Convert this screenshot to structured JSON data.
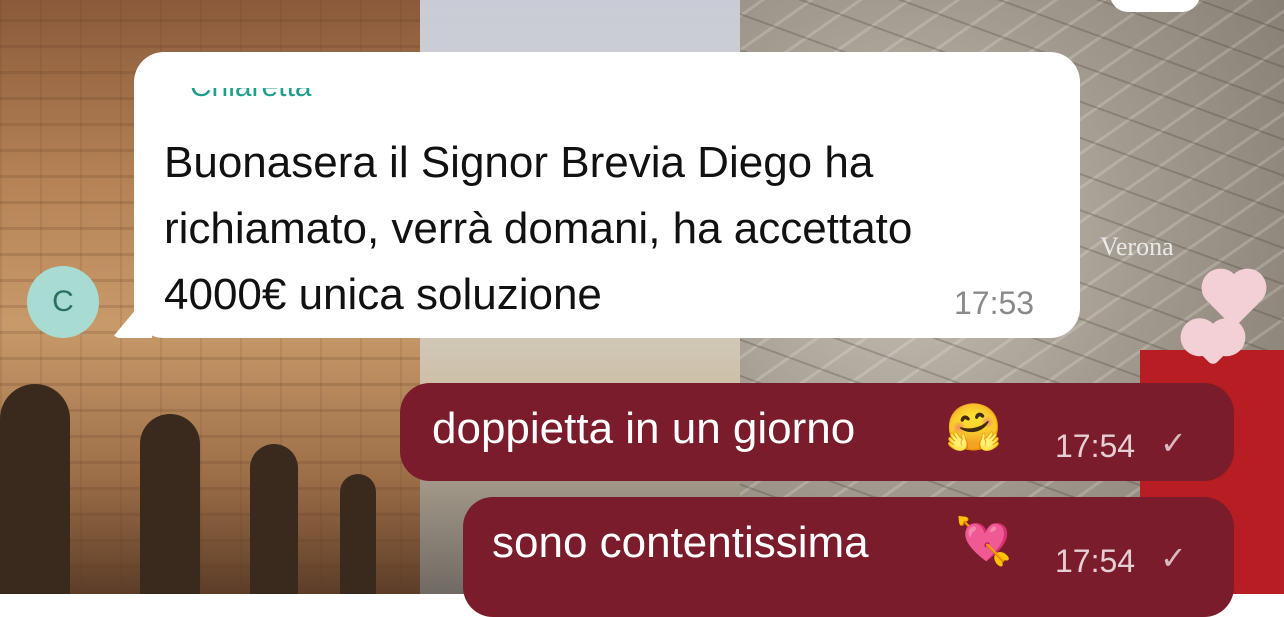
{
  "chat": {
    "top_partial_bubble": "",
    "incoming": {
      "avatar_initial": "C",
      "sender_name": "~ Chiaretta",
      "text": "Buonasera il Signor Brevia Diego ha richiamato, verrà domani, ha accettato 4000€ unica soluzione",
      "time": "17:53"
    },
    "outgoing": [
      {
        "text": "doppietta in un giorno",
        "emoji": "🤗",
        "time": "17:54",
        "status": "✓"
      },
      {
        "text": "sono contentissima",
        "emoji": "💘",
        "time": "17:54",
        "status": "✓"
      }
    ]
  },
  "wallpaper": {
    "wall_label": "Verona"
  },
  "colors": {
    "outgoing_bubble": "#7a1c2b",
    "incoming_bubble": "#ffffff",
    "sender_name": "#1f9e8c",
    "avatar_bg": "#a8dcd3"
  }
}
